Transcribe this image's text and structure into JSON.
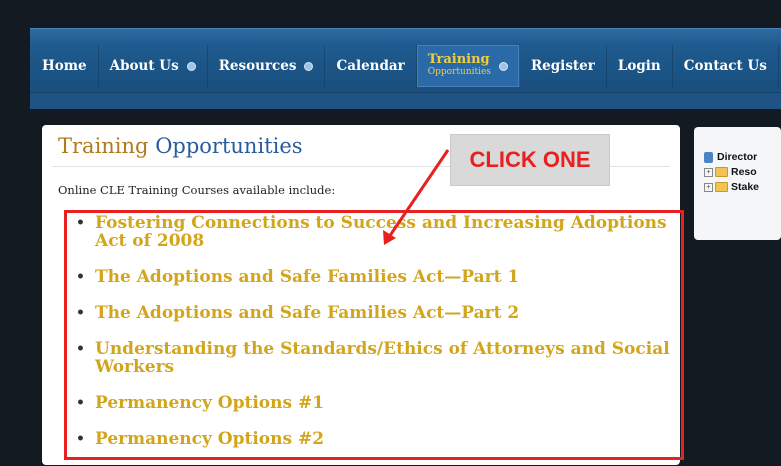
{
  "nav": {
    "items": [
      {
        "label": "Home",
        "has_dropdown": false
      },
      {
        "label": "About Us",
        "has_dropdown": true
      },
      {
        "label": "Resources",
        "has_dropdown": true
      },
      {
        "label": "Calendar",
        "has_dropdown": false
      },
      {
        "label": "Training",
        "sublabel": "Opportunities",
        "has_dropdown": true,
        "active": true
      },
      {
        "label": "Register",
        "has_dropdown": false
      },
      {
        "label": "Login",
        "has_dropdown": false
      },
      {
        "label": "Contact Us",
        "has_dropdown": false
      }
    ]
  },
  "main": {
    "title_part1": "Training",
    "title_part2": "Opportunities",
    "intro": "Online CLE Training Courses available include:",
    "courses": [
      "Fostering Connections to Success and Increasing Adoptions Act of 2008",
      "The Adoptions and Safe Families Act—Part 1",
      "The Adoptions and Safe Families Act—Part 2",
      "Understanding the Standards/Ethics of Attorneys and Social Workers",
      "Permanency Options #1",
      "Permanency Options #2"
    ]
  },
  "annotation": {
    "callout_text": "CLICK ONE"
  },
  "sidebar": {
    "items": [
      "Director",
      "Reso",
      "Stake"
    ]
  },
  "colors": {
    "nav_bg": "#1f5b8f",
    "course_link": "#d2a51a",
    "title_orange": "#b07a1e",
    "title_blue": "#2a5b9c",
    "annotation_red": "#e8201f"
  }
}
